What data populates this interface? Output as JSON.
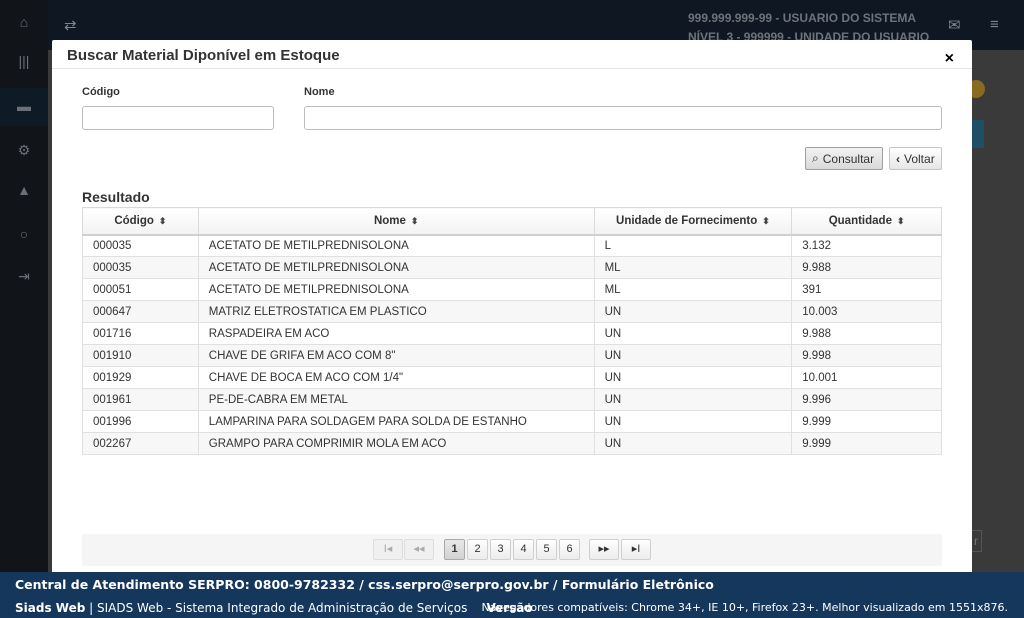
{
  "header": {
    "user_cpf": "999.999.999-99 - USUARIO DO SISTEMA",
    "user_level": "NÍVEL 3 - 999999 - UNIDADE DO USUARIO"
  },
  "modal": {
    "title": "Buscar Material Diponível em Estoque",
    "close_label": "×",
    "codigo_label": "Código",
    "codigo_value": "",
    "nome_label": "Nome",
    "nome_value": "",
    "consultar_label": "Consultar",
    "voltar_label": "Voltar",
    "result_title": "Resultado",
    "columns": [
      "Código",
      "Nome",
      "Unidade de Fornecimento",
      "Quantidade"
    ],
    "rows": [
      {
        "codigo": "000035",
        "nome": "ACETATO DE METILPREDNISOLONA",
        "unidade": "L",
        "quantidade": "3.132"
      },
      {
        "codigo": "000035",
        "nome": "ACETATO DE METILPREDNISOLONA",
        "unidade": "ML",
        "quantidade": "9.988"
      },
      {
        "codigo": "000051",
        "nome": "ACETATO DE METILPREDNISOLONA",
        "unidade": "ML",
        "quantidade": "391"
      },
      {
        "codigo": "000647",
        "nome": "MATRIZ ELETROSTATICA EM PLASTICO",
        "unidade": "UN",
        "quantidade": "10.003"
      },
      {
        "codigo": "001716",
        "nome": "RASPADEIRA EM ACO",
        "unidade": "UN",
        "quantidade": "9.988"
      },
      {
        "codigo": "001910",
        "nome": "CHAVE DE GRIFA EM ACO COM 8\"",
        "unidade": "UN",
        "quantidade": "9.998"
      },
      {
        "codigo": "001929",
        "nome": "CHAVE DE BOCA EM ACO COM 1/4\"",
        "unidade": "UN",
        "quantidade": "10.001"
      },
      {
        "codigo": "001961",
        "nome": "PE-DE-CABRA EM METAL",
        "unidade": "UN",
        "quantidade": "9.996"
      },
      {
        "codigo": "001996",
        "nome": "LAMPARINA PARA SOLDAGEM PARA SOLDA DE ESTANHO",
        "unidade": "UN",
        "quantidade": "9.999"
      },
      {
        "codigo": "002267",
        "nome": "GRAMPO PARA COMPRIMIR MOLA EM ACO",
        "unidade": "UN",
        "quantidade": "9.999"
      }
    ],
    "pagination": {
      "first_label": "I◂",
      "prev_label": "◂◂",
      "pages": [
        "1",
        "2",
        "3",
        "4",
        "5",
        "6"
      ],
      "current_page": "1",
      "next_label": "▸▸",
      "last_label": "▸I"
    }
  },
  "footer": {
    "line1": "Central de Atendimento SERPRO: 0800-9782332 / css.serpro@serpro.gov.br / Formulário Eletrônico",
    "app_name": "Siads Web",
    "app_full": "SIADS Web - Sistema Integrado de Administração de Serviços",
    "version_label": "Versão",
    "browsers": "Navegadores compatíveis: Chrome 34+, IE 10+, Firefox 23+. Melhor visualizado em 1551x876."
  }
}
